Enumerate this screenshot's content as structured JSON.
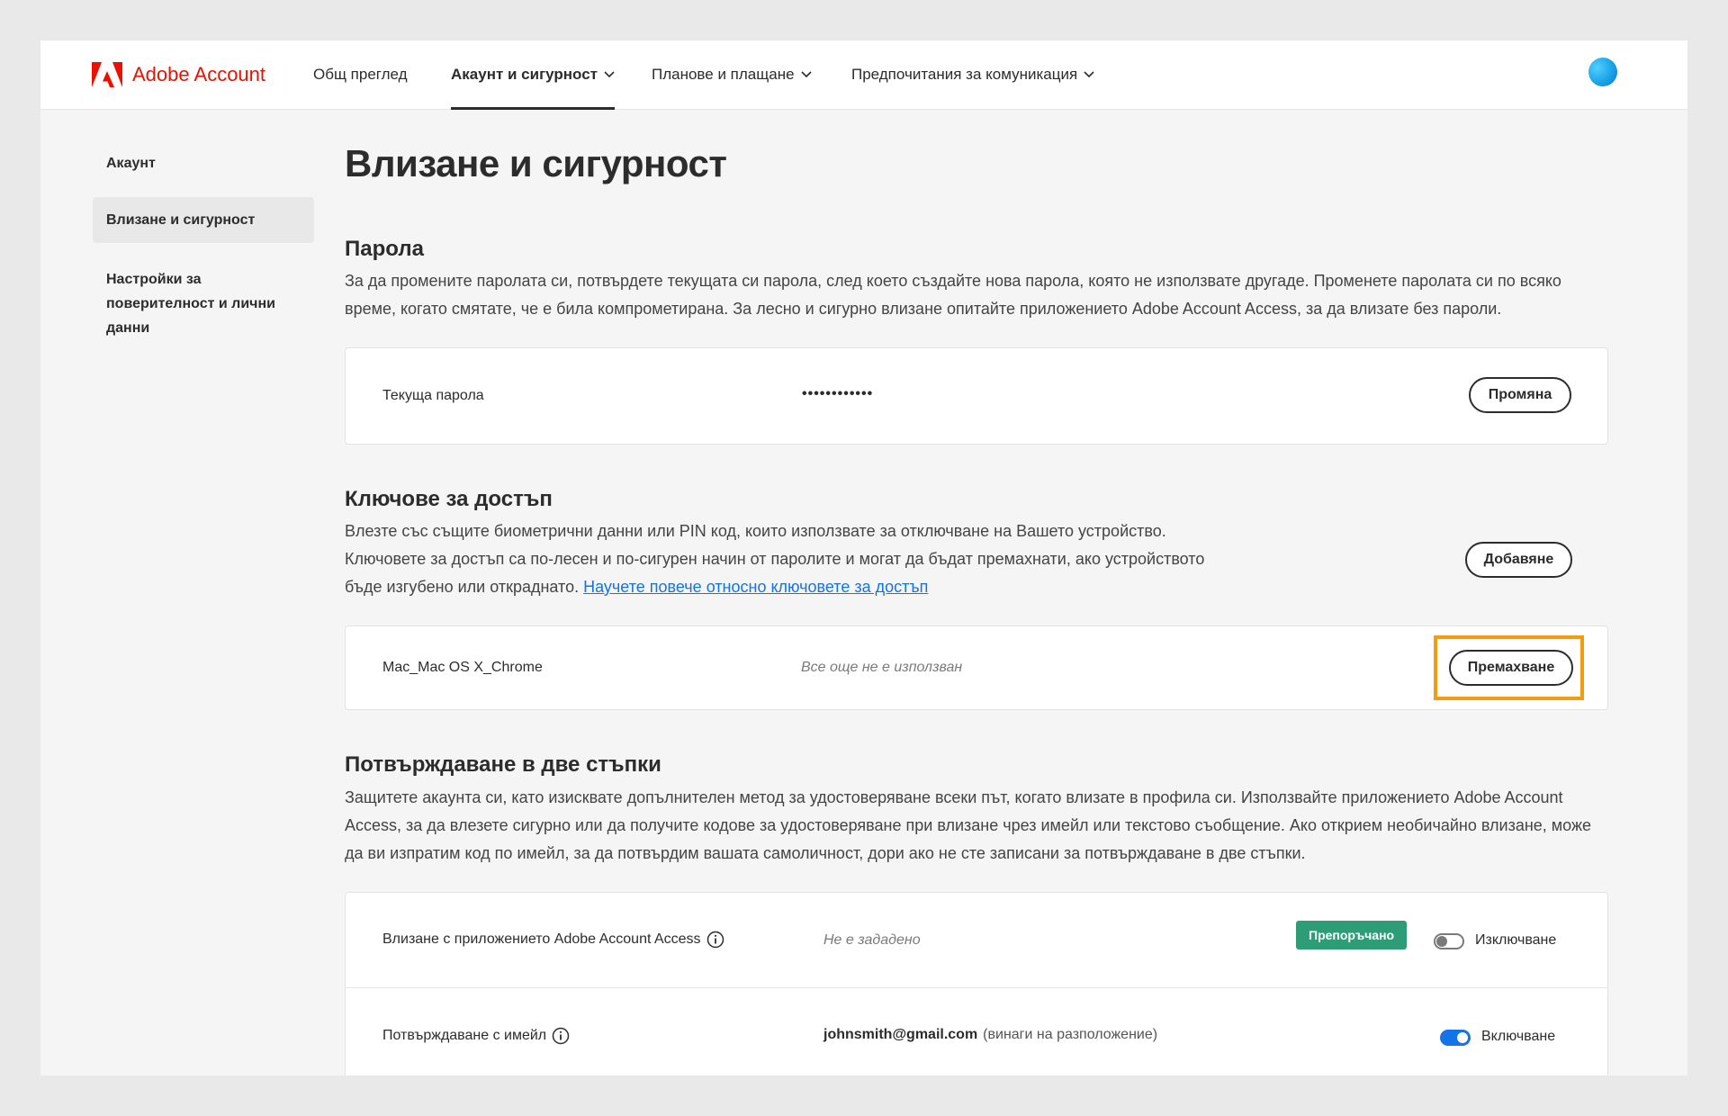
{
  "colors": {
    "brand": "#eb1000",
    "link": "#1473e6",
    "recommended_badge": "#2d9d78",
    "toggle_on": "#1473e6",
    "highlight": "#f39c12"
  },
  "header": {
    "brand_name": "Adobe Account",
    "logo_icon": "adobe-logo-icon",
    "nav": [
      {
        "label": "Общ преглед"
      },
      {
        "label": "Акаунт и сигурност"
      },
      {
        "label": "Планове и плащане"
      },
      {
        "label": "Предпочитания за комуникация"
      }
    ]
  },
  "sidebar": {
    "items": [
      {
        "label": "Акаунт"
      },
      {
        "label": "Влизане и сигурност"
      },
      {
        "label": "Настройки за поверителност и лични данни"
      }
    ]
  },
  "main": {
    "title": "Влизане и сигурност",
    "password": {
      "heading": "Парола",
      "description": "За да промените паролата си, потвърдете текущата си парола, след което създайте нова парола, която не използвате другаде. Променете паролата си по всяко време, когато смятате, че е била компрометирана. За лесно и сигурно влизане опитайте приложението Adobe Account Access, за да влизате без пароли.",
      "current_label": "Текуща парола",
      "masked_value": "••••••••••••",
      "change_button": "Промяна"
    },
    "passkeys": {
      "heading": "Ключове за достъп",
      "line1": "Влезте със същите биометрични данни или PIN код, които използвате за отключване на Вашето устройство.",
      "line2": "Ключовете за достъп са по-лесен и по-сигурен начин от паролите и могат да бъдат премахнати, ако устройството",
      "line3": "бъде изгубено или откраднато.",
      "link": "Научете повече относно ключовете за достъп",
      "add_button": "Добавяне",
      "device": {
        "name": "Mac_Mac OS X_Chrome",
        "status": "Все още не е използван",
        "remove_button": "Премахване"
      }
    },
    "two_step": {
      "heading": "Потвърждаване в две стъпки",
      "description": "Защитете акаунта си, като изисквате допълнителен метод за удостоверяване всеки път, когато влизате в профила си. Използвайте приложението Adobe Account Access, за да влезете сигурно или да получите кодове за удостоверяване при влизане чрез имейл или текстово съобщение. Ако открием необичайно влизане, може да ви изпратим код по имейл, за да потвърдим вашата самоличност, дори ако не сте записани за потвърждаване в две стъпки.",
      "rows": [
        {
          "label": "Влизане с приложението Adobe Account Access",
          "value": "Не е зададено",
          "badge": "Препоръчано",
          "toggle_state": "off",
          "toggle_label": "Изключване"
        },
        {
          "label": "Потвърждаване с имейл",
          "email": "johnsmith@gmail.com",
          "email_note": "(винаги на разположение)",
          "toggle_state": "on",
          "toggle_label": "Включване"
        }
      ]
    }
  }
}
